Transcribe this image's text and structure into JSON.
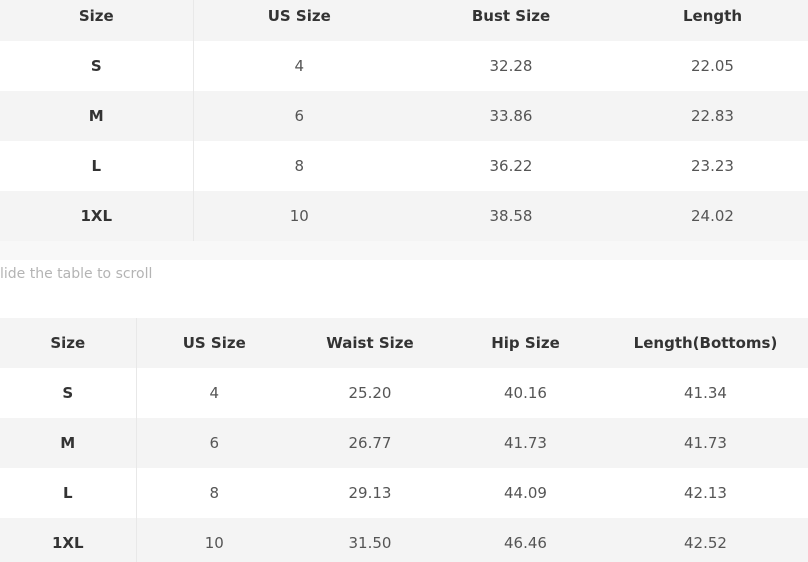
{
  "table_top": {
    "headers": [
      "Size",
      "US Size",
      "Bust Size",
      "Length"
    ],
    "rows": [
      [
        "S",
        "4",
        "32.28",
        "22.05"
      ],
      [
        "M",
        "6",
        "33.86",
        "22.83"
      ],
      [
        "L",
        "8",
        "36.22",
        "23.23"
      ],
      [
        "1XL",
        "10",
        "38.58",
        "24.02"
      ]
    ]
  },
  "scroll_hint": "lide the table to scroll",
  "table_bottom": {
    "headers": [
      "Size",
      "US Size",
      "Waist Size",
      "Hip Size",
      "Length(Bottoms)"
    ],
    "rows": [
      [
        "S",
        "4",
        "25.20",
        "40.16",
        "41.34"
      ],
      [
        "M",
        "6",
        "26.77",
        "41.73",
        "41.73"
      ],
      [
        "L",
        "8",
        "29.13",
        "44.09",
        "42.13"
      ],
      [
        "1XL",
        "10",
        "31.50",
        "46.46",
        "42.52"
      ]
    ]
  },
  "colors": {
    "row_stripe": "#f4f4f4",
    "header_text": "#333333",
    "value_text": "#555555",
    "hint_text": "#b4b4b4",
    "divider": "#e8e8e8"
  }
}
